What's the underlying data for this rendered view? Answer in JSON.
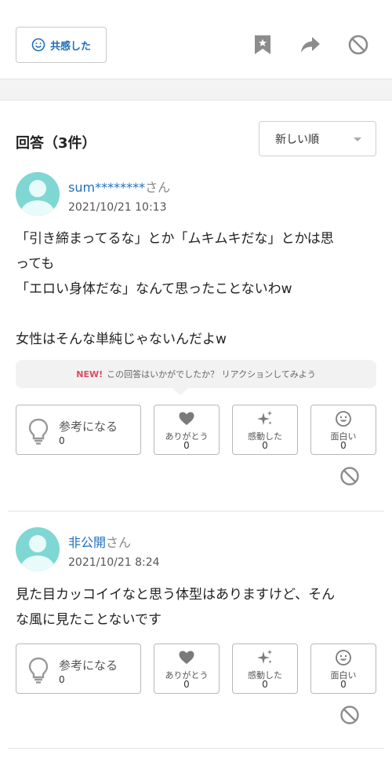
{
  "toolbar": {
    "empathy_label": "共感した",
    "icons": [
      "bookmark-icon",
      "share-icon",
      "block-icon"
    ]
  },
  "answers_section": {
    "heading": "回答（3件）",
    "sort": {
      "selected": "新しい順"
    },
    "prompt": {
      "new_badge": "NEW!",
      "text": "この回答はいかがでしたか？ リアクションしてみよう"
    }
  },
  "reaction_labels": {
    "helpful": "参考になる",
    "thanks": "ありがとう",
    "moved": "感動した",
    "funny": "面白い"
  },
  "answers": [
    {
      "username": "sum********",
      "suffix": "さん",
      "timestamp": "2021/10/21 10:13",
      "lines": [
        "「引き締まってるな」とか「ムキムキだな」とかは思",
        "っても",
        "「エロい身体だな」なんて思ったことないわw",
        "",
        "女性はそんな単純じゃないんだよw"
      ],
      "reactions": {
        "helpful": "0",
        "thanks": "0",
        "moved": "0",
        "funny": "0"
      }
    },
    {
      "username": "非公開",
      "suffix": "さん",
      "timestamp": "2021/10/21 8:24",
      "lines": [
        "見た目カッコイイなと思う体型はありますけど、そん",
        "な風に見たことないです"
      ],
      "reactions": {
        "helpful": "0",
        "thanks": "0",
        "moved": "0",
        "funny": "0"
      }
    }
  ],
  "colors": {
    "link": "#1f6fbd",
    "new_badge": "#e04860",
    "avatar": "#7fd7d3"
  }
}
